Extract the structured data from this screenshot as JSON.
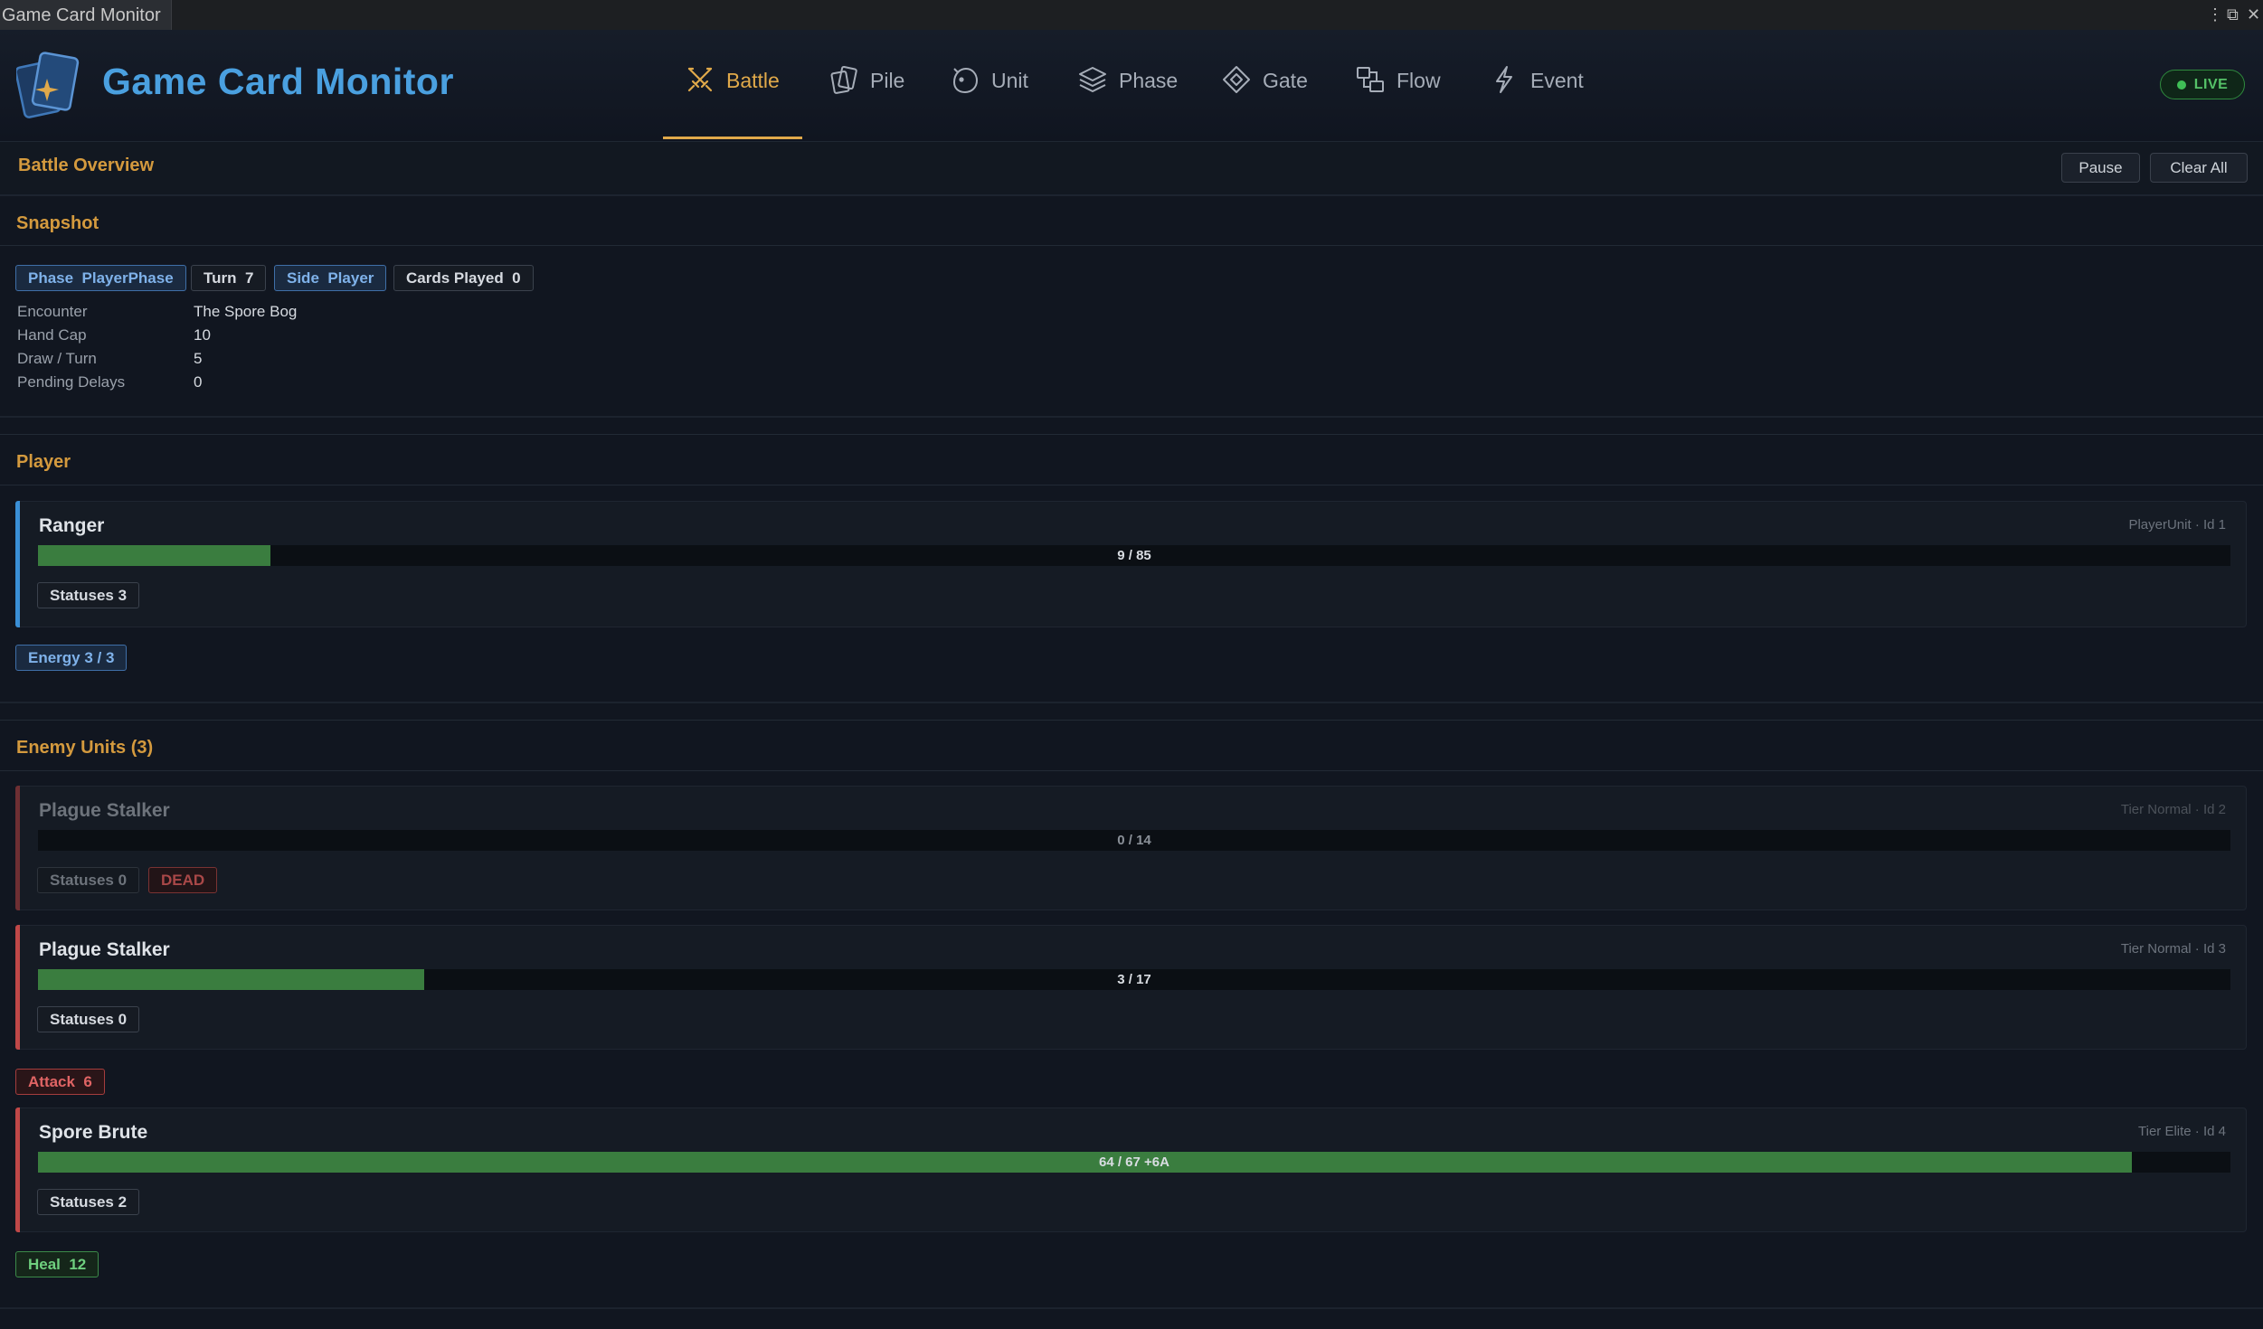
{
  "window": {
    "title": "Game Card Monitor",
    "controls": [
      "⋮",
      "⧉",
      "✕"
    ]
  },
  "header": {
    "app_title": "Game Card Monitor",
    "live_label": "LIVE",
    "tabs": [
      {
        "label": "Battle",
        "icon": "crossed-swords-icon",
        "active": true
      },
      {
        "label": "Pile",
        "icon": "cards-pile-icon",
        "active": false
      },
      {
        "label": "Unit",
        "icon": "unit-face-icon",
        "active": false
      },
      {
        "label": "Phase",
        "icon": "layers-icon",
        "active": false
      },
      {
        "label": "Gate",
        "icon": "diamond-gate-icon",
        "active": false
      },
      {
        "label": "Flow",
        "icon": "flow-icon",
        "active": false
      },
      {
        "label": "Event",
        "icon": "lightning-icon",
        "active": false
      }
    ]
  },
  "overview": {
    "title": "Battle Overview",
    "pause_label": "Pause",
    "clear_label": "Clear All"
  },
  "snapshot": {
    "title": "Snapshot",
    "chips": {
      "phase": "Phase  PlayerPhase",
      "turn": "Turn  7",
      "side": "Side  Player",
      "cards_played": "Cards Played  0"
    },
    "rows": [
      {
        "key": "Encounter",
        "value": "The Spore Bog"
      },
      {
        "key": "Hand Cap",
        "value": "10"
      },
      {
        "key": "Draw / Turn",
        "value": "5"
      },
      {
        "key": "Pending Delays",
        "value": "0"
      }
    ]
  },
  "player": {
    "title": "Player",
    "unit": {
      "name": "Ranger",
      "meta": "PlayerUnit  ·  Id 1",
      "hp_text": "9 / 85",
      "hp_fraction": 0.106,
      "statuses": "Statuses 3"
    },
    "energy": "Energy 3 / 3"
  },
  "enemies": {
    "title": "Enemy Units (3)",
    "units": [
      {
        "name": "Plague Stalker",
        "meta": "Tier Normal  ·  Id 2",
        "hp_text": "0 / 14",
        "hp_fraction": 0,
        "statuses": "Statuses 0",
        "dead_label": "DEAD"
      },
      {
        "name": "Plague Stalker",
        "meta": "Tier Normal  ·  Id 3",
        "hp_text": "3 / 17",
        "hp_fraction": 0.176,
        "statuses": "Statuses 0",
        "intent": "Attack  6"
      },
      {
        "name": "Spore Brute",
        "meta": "Tier Elite  ·  Id 4",
        "hp_text": "64 / 67  +6A",
        "hp_fraction": 0.955,
        "statuses": "Statuses 2",
        "intent": "Heal  12"
      }
    ]
  },
  "colors": {
    "accent_gold": "#e0a94a",
    "title_blue": "#4aa0e0",
    "hp_green": "#3a7d3f",
    "player_accent": "#3a8fd6",
    "enemy_accent": "#c04848",
    "live_green": "#55c268"
  }
}
